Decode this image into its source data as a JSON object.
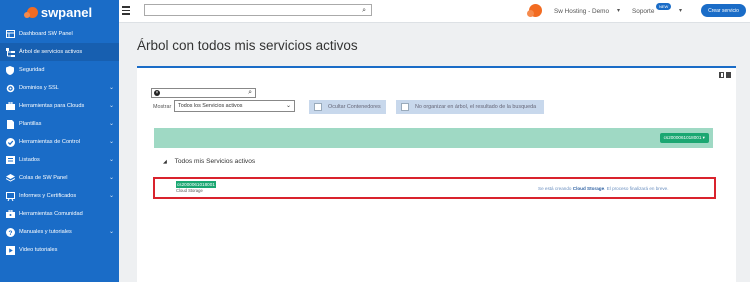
{
  "app": {
    "name": "swpanel"
  },
  "topbar": {
    "search_placeholder": "",
    "user_name": "Sw Hosting - Demo",
    "support_label": "Soporte",
    "new_badge": "NEW",
    "create_button": "Crear servicio"
  },
  "sidebar": {
    "items": [
      {
        "label": "Dashboard SW Panel",
        "icon": "dashboard-icon",
        "chevron": false
      },
      {
        "label": "Árbol de servicios activos",
        "icon": "tree-icon",
        "chevron": false
      },
      {
        "label": "Seguridad",
        "icon": "shield-icon",
        "chevron": false
      },
      {
        "label": "Dominios y SSL",
        "icon": "domain-gear-icon",
        "chevron": true
      },
      {
        "label": "Herramientas para Clouds",
        "icon": "toolbox-icon",
        "chevron": true
      },
      {
        "label": "Plantillas",
        "icon": "file-icon",
        "chevron": true
      },
      {
        "label": "Herramientas de Control",
        "icon": "check-circle-icon",
        "chevron": true
      },
      {
        "label": "Listados",
        "icon": "list-icon",
        "chevron": true
      },
      {
        "label": "Colas de SW Panel",
        "icon": "layers-icon",
        "chevron": true
      },
      {
        "label": "Informes y Certificados",
        "icon": "report-icon",
        "chevron": true
      },
      {
        "label": "Herramientas Comunidad",
        "icon": "community-toolbox-icon",
        "chevron": false
      },
      {
        "label": "Manuales y tutoriales",
        "icon": "help-icon",
        "chevron": true
      },
      {
        "label": "Video tutoriales",
        "icon": "video-icon",
        "chevron": false
      }
    ]
  },
  "main": {
    "title": "Árbol con todos mis servicios activos",
    "filter_value": "",
    "mostrar_label": "Mostrar",
    "select_value": "Todos los Servicios activos",
    "checkbox_containers": "Ocultar Contenedores",
    "checkbox_no_tree": "No organizar en árbol, el resultado de la busqueda",
    "bar_tag": "cs2000061018001",
    "tree_root": "Todos mis Servicios activos",
    "service": {
      "name": "cs2000061018001",
      "type": "Cloud Storage",
      "message_prefix": "Se está creando",
      "message_service": "Cloud Storage",
      "message_suffix": ". El proceso finalizará en breve."
    }
  },
  "colors": {
    "accent": "#1a6cc7",
    "success": "#1ba772",
    "highlight": "#d9232d",
    "brand_orange": "#f26b21"
  }
}
